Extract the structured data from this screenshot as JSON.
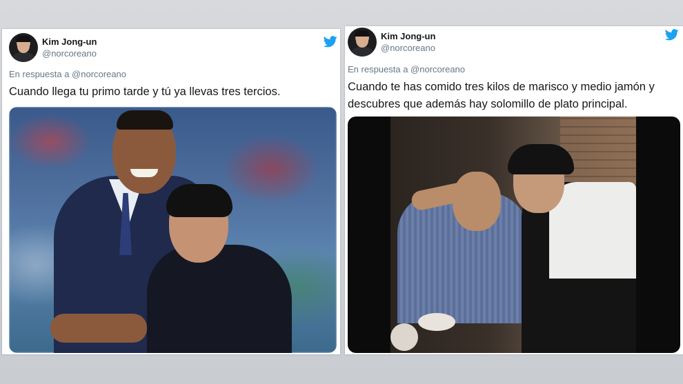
{
  "colors": {
    "twitter_blue": "#1da1f2",
    "text_primary": "#14171a",
    "text_secondary": "#657786"
  },
  "tweets": [
    {
      "author_name": "Kim Jong-un",
      "handle": "@norcoreano",
      "reply_context": "En respuesta a @norcoreano",
      "text": "Cuando llega tu primo tarde y tú ya llevas tres tercios.",
      "media_icon": "twitter-bird-icon"
    },
    {
      "author_name": "Kim Jong-un",
      "handle": "@norcoreano",
      "reply_context": "En respuesta a @norcoreano",
      "text": "Cuando te has comido tres kilos de marisco y medio jamón y descubres que además hay solomillo de plato principal.",
      "media_icon": "twitter-bird-icon"
    }
  ]
}
